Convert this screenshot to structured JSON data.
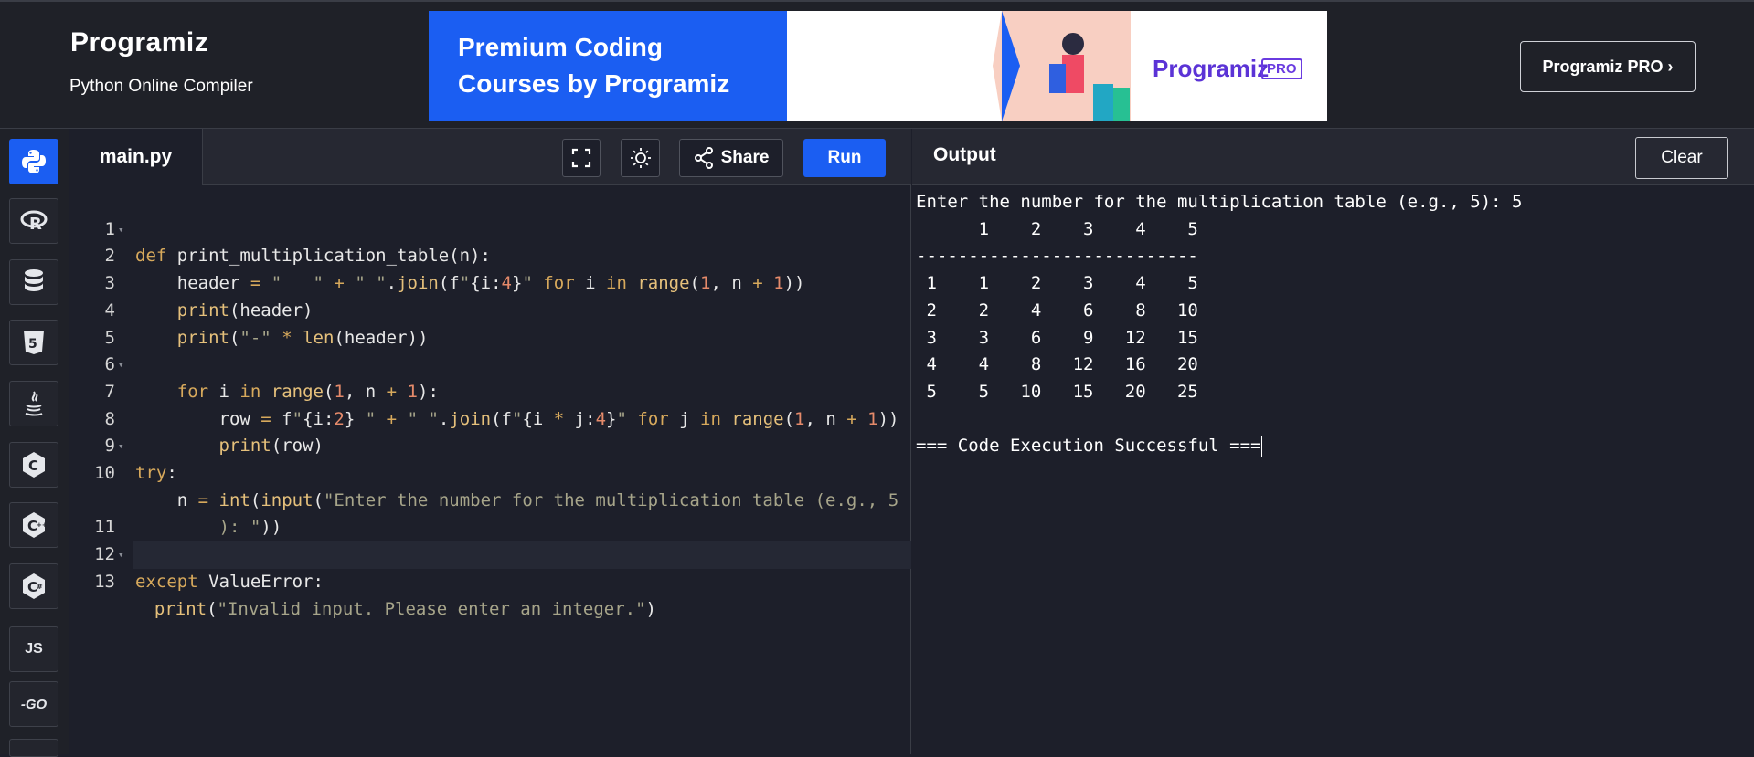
{
  "header": {
    "logo": "Programiz",
    "subtitle": "Python Online Compiler",
    "pro_button": "Programiz PRO ›"
  },
  "banner": {
    "line1": "Premium Coding",
    "line2": "Courses by Programiz",
    "logo": "Programiz",
    "pro_badge": "PRO"
  },
  "sidebar": {
    "languages": [
      {
        "icon": "python-icon",
        "active": true
      },
      {
        "icon": "r-icon"
      },
      {
        "icon": "database-icon"
      },
      {
        "icon": "html5-icon"
      },
      {
        "icon": "java-icon"
      },
      {
        "icon": "c-icon"
      },
      {
        "icon": "cpp-icon"
      },
      {
        "icon": "csharp-icon"
      },
      {
        "icon": "js-icon",
        "label": "JS"
      },
      {
        "icon": "go-icon",
        "label": "-GO"
      }
    ]
  },
  "editor": {
    "file_tab": "main.py",
    "share_label": "Share",
    "run_label": "Run",
    "line_numbers": [
      "1",
      "2",
      "3",
      "4",
      "5",
      "6",
      "7",
      "8",
      "9",
      "10",
      "",
      "11",
      "12",
      "13"
    ]
  },
  "output": {
    "title": "Output",
    "clear_label": "Clear",
    "lines": [
      "Enter the number for the multiplication table (e.g., 5): 5",
      "      1    2    3    4    5",
      "---------------------------",
      " 1    1    2    3    4    5",
      " 2    2    4    6    8   10",
      " 3    3    6    9   12   15",
      " 4    4    8   12   16   20",
      " 5    5   10   15   20   25",
      "",
      "=== Code Execution Successful ==="
    ]
  },
  "colors": {
    "accent": "#1b5ef2",
    "background": "#1d1f2a",
    "keyword": "#d7a95c",
    "string": "#a7a58a",
    "number": "#e58a6a"
  }
}
